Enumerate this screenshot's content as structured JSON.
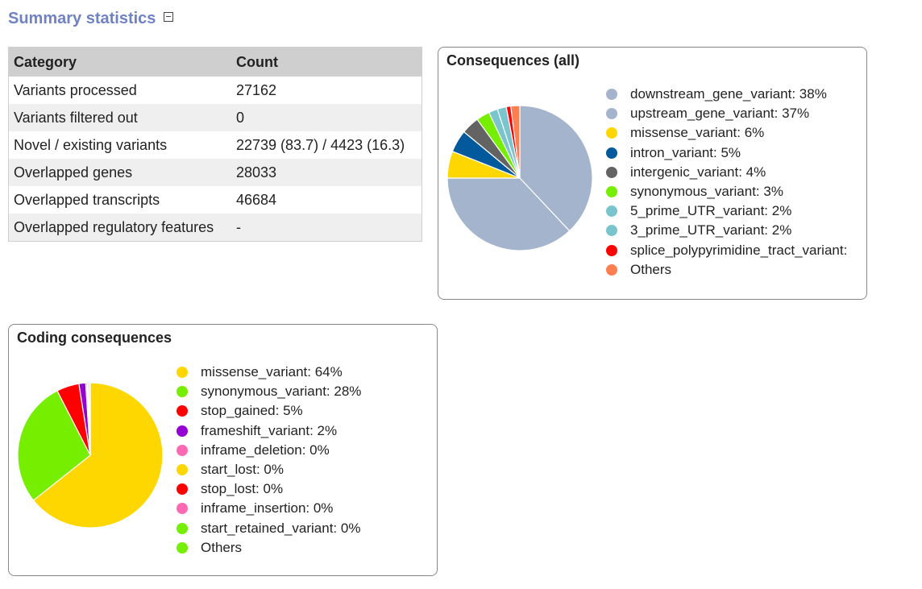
{
  "header": {
    "title": "Summary statistics"
  },
  "stats_table": {
    "columns": [
      "Category",
      "Count"
    ],
    "rows": [
      [
        "Variants processed",
        "27162"
      ],
      [
        "Variants filtered out",
        "0"
      ],
      [
        "Novel / existing variants",
        "22739 (83.7) / 4423 (16.3)"
      ],
      [
        "Overlapped genes",
        "28033"
      ],
      [
        "Overlapped transcripts",
        "46684"
      ],
      [
        "Overlapped regulatory features",
        "-"
      ]
    ]
  },
  "chart_data": [
    {
      "type": "pie",
      "title": "Consequences (all)",
      "slices": [
        {
          "label": "downstream_gene_variant: 38%",
          "value": 38,
          "color": "#a3b4cc"
        },
        {
          "label": "upstream_gene_variant: 37%",
          "value": 37,
          "color": "#a3b4cc"
        },
        {
          "label": "missense_variant: 6%",
          "value": 6,
          "color": "#ffd700"
        },
        {
          "label": "intron_variant: 5%",
          "value": 5,
          "color": "#02599c"
        },
        {
          "label": "intergenic_variant: 4%",
          "value": 4,
          "color": "#636363"
        },
        {
          "label": "synonymous_variant: 3%",
          "value": 3,
          "color": "#76ee00"
        },
        {
          "label": "5_prime_UTR_variant: 2%",
          "value": 2,
          "color": "#7ac5cd"
        },
        {
          "label": "3_prime_UTR_variant: 2%",
          "value": 2,
          "color": "#7ac5cd"
        },
        {
          "label": "splice_polypyrimidine_tract_variant:",
          "value": 1,
          "color": "#ff0000"
        },
        {
          "label": "Others",
          "value": 2,
          "color": "#ff7f50"
        }
      ]
    },
    {
      "type": "pie",
      "title": "Coding consequences",
      "slices": [
        {
          "label": "missense_variant: 64%",
          "value": 64,
          "color": "#ffd700"
        },
        {
          "label": "synonymous_variant: 28%",
          "value": 28,
          "color": "#76ee00"
        },
        {
          "label": "stop_gained: 5%",
          "value": 5,
          "color": "#ff0000"
        },
        {
          "label": "frameshift_variant: 2%",
          "value": 1.5,
          "color": "#9400d3"
        },
        {
          "label": "inframe_deletion: 0%",
          "value": 0.3,
          "color": "#ff69b4"
        },
        {
          "label": "start_lost: 0%",
          "value": 0.1,
          "color": "#ffd700"
        },
        {
          "label": "stop_lost: 0%",
          "value": 0.1,
          "color": "#ff0000"
        },
        {
          "label": "inframe_insertion: 0%",
          "value": 0.3,
          "color": "#ff69b4"
        },
        {
          "label": "start_retained_variant: 0%",
          "value": 0.1,
          "color": "#76ee00"
        },
        {
          "label": "Others",
          "value": 0.1,
          "color": "#76ee00"
        }
      ]
    }
  ]
}
